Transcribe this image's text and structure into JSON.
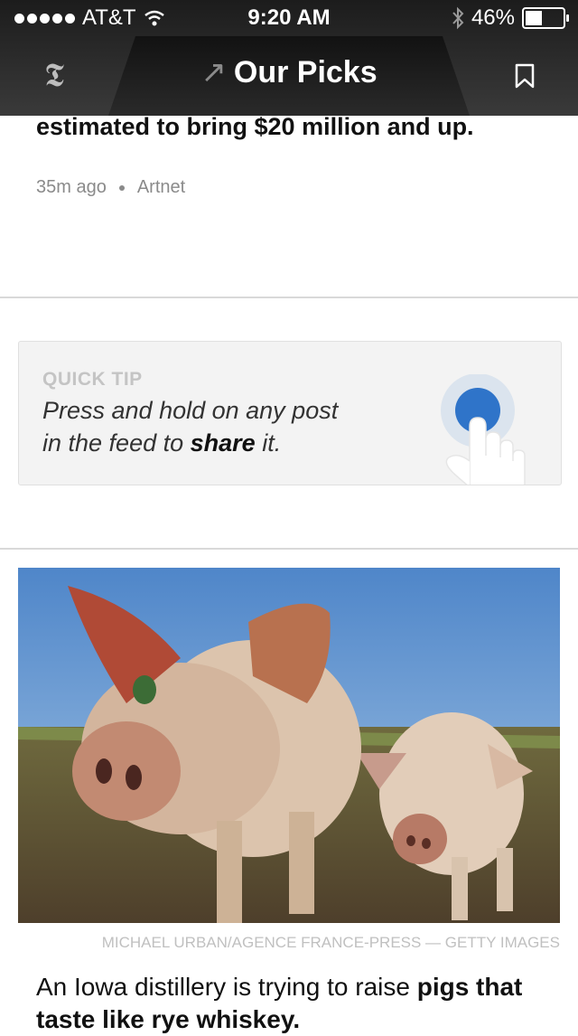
{
  "status_bar": {
    "carrier": "AT&T",
    "time": "9:20 AM",
    "battery": "46%",
    "battery_level": 0.46
  },
  "nav": {
    "title": "Our Picks",
    "logo_glyph": "𝕿",
    "arrow_glyph": "↗"
  },
  "feed": {
    "headline_tail": "estimated to bring $20 million and up.",
    "age": "35m ago",
    "source": "Artnet"
  },
  "quick_tip": {
    "label": "QUICK TIP",
    "line1": "Press and hold on any post",
    "line2_before": "in the feed to ",
    "line2_bold": "share",
    "line2_after": " it."
  },
  "photo_story": {
    "credit": "MICHAEL URBAN/AGENCE FRANCE-PRESS — GETTY IMAGES",
    "text_before": "An Iowa distillery is trying to raise ",
    "text_bold": "pigs that taste like rye whiskey."
  },
  "colors": {
    "bar_dark": "#2a2a2a",
    "tip_bg": "#f3f3f3",
    "touch_blue": "#2f74c9",
    "meta_gray": "#8a8a8a"
  }
}
